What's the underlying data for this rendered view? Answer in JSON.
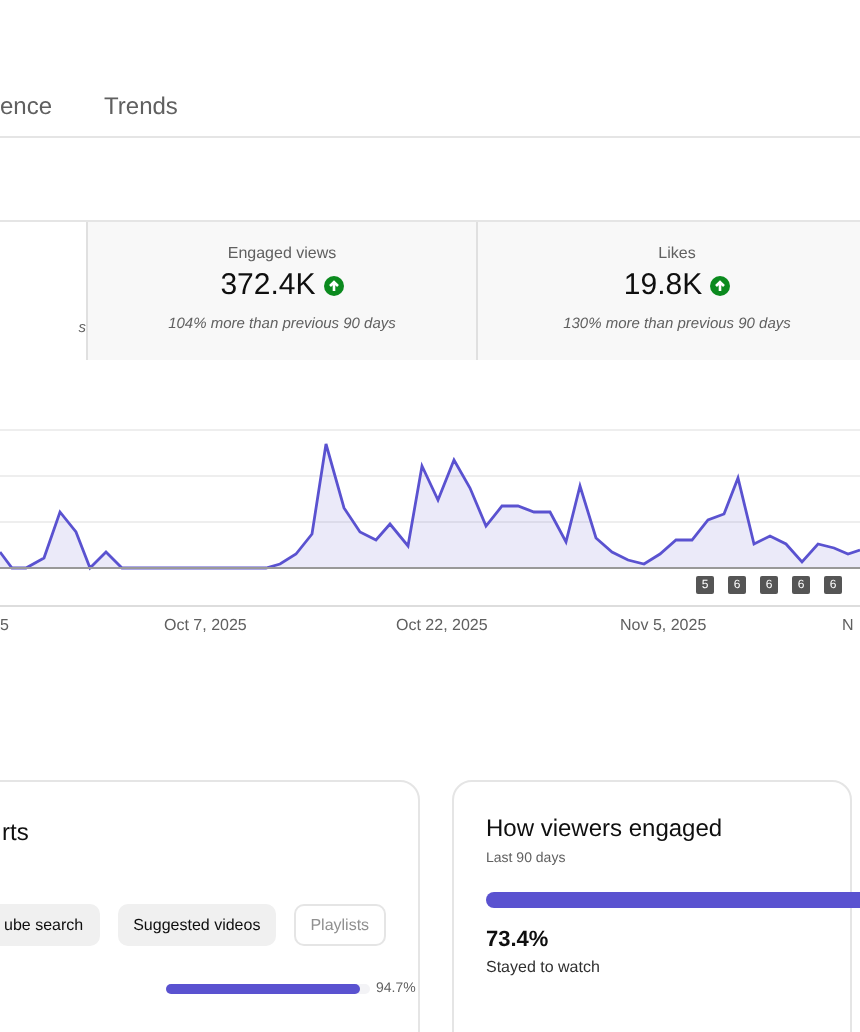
{
  "tabs": [
    {
      "label": "ence",
      "selected": false
    },
    {
      "label": "Trends",
      "selected": false
    }
  ],
  "metrics": [
    {
      "change": "s",
      "selected": true
    },
    {
      "label": "Engaged views",
      "value": "372.4K",
      "change": "104% more than previous 90 days",
      "up": true,
      "selected": false
    },
    {
      "label": "Likes",
      "value": "19.8K",
      "change": "130% more than previous 90 days",
      "up": true,
      "selected": false
    }
  ],
  "chart": {
    "markers": [
      "5",
      "6",
      "6",
      "6",
      "6"
    ],
    "x_labels": [
      "5",
      "Oct 7, 2025",
      "Oct 22, 2025",
      "Nov 5, 2025",
      "N"
    ]
  },
  "traffic_card": {
    "title": "rts",
    "chips": [
      {
        "label": "ube search",
        "selected": false
      },
      {
        "label": "Suggested videos",
        "selected": false
      },
      {
        "label": "Playlists",
        "selected": true
      }
    ],
    "bar": {
      "level": 0.947,
      "reading": "94.7%"
    }
  },
  "engagement_card": {
    "title": "How viewers engaged",
    "subtitle": "Last 90 days",
    "value": "73.4%",
    "caption": "Stayed to watch"
  }
}
